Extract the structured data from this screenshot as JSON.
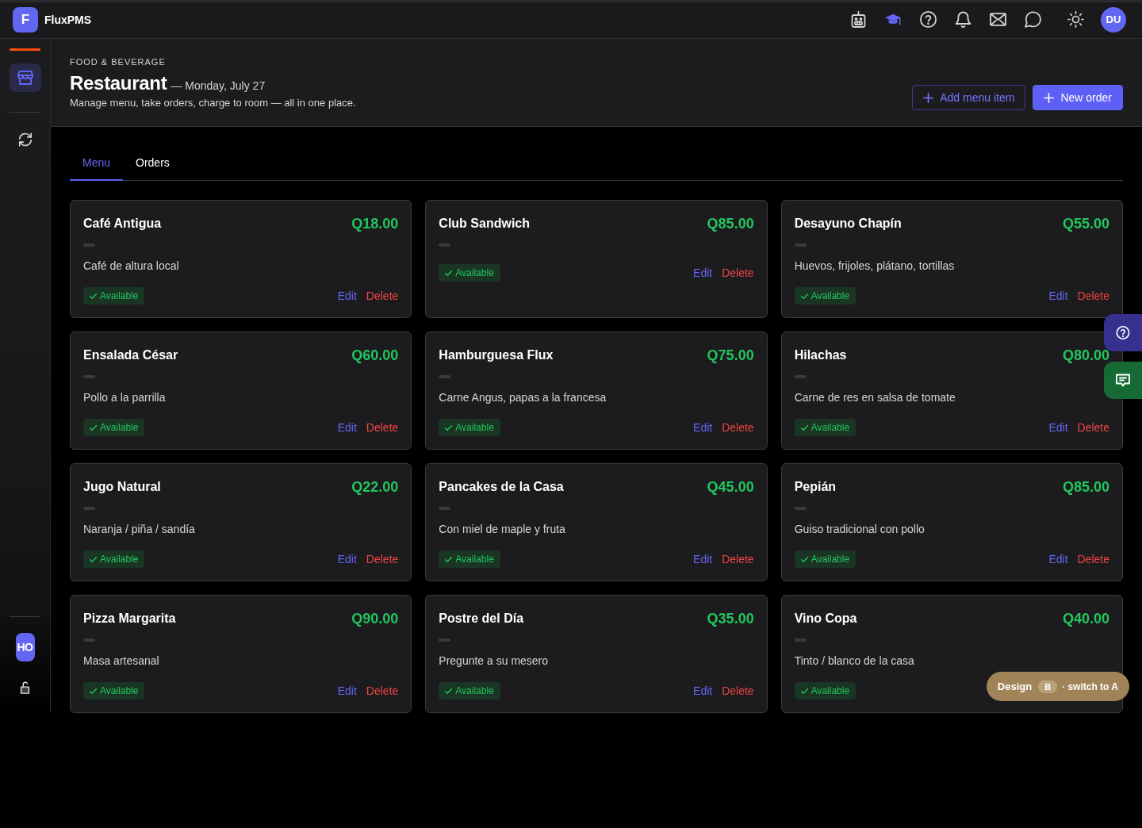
{
  "app": {
    "logo_letter": "F",
    "name": "FluxPMS"
  },
  "topbar": {
    "avatar": "DU"
  },
  "sidebar": {
    "items": [
      {
        "kind": "store",
        "selected": true
      },
      {
        "kind": "refresh",
        "selected": false
      }
    ],
    "property": "HO"
  },
  "header": {
    "eyebrow": "FOOD & BEVERAGE",
    "title": "Restaurant",
    "date": "— Monday, July 27",
    "subtitle": "Manage menu, take orders, charge to room — all in one place.",
    "buttons": [
      {
        "kind": "outline",
        "label": "Add menu item"
      },
      {
        "kind": "primary",
        "label": "New order"
      }
    ]
  },
  "tabs": [
    {
      "label": "Menu",
      "selected": true
    },
    {
      "label": "Orders",
      "selected": false
    }
  ],
  "menu_items": [
    {
      "name": "Café Antigua",
      "price": "Q18.00",
      "description": "Café de altura local",
      "status": "Available",
      "available": true,
      "edit": "Edit",
      "delete": "Delete"
    },
    {
      "name": "Club Sandwich",
      "price": "Q85.00",
      "status": "Available",
      "available": true,
      "edit": "Edit",
      "delete": "Delete"
    },
    {
      "name": "Desayuno Chapín",
      "price": "Q55.00",
      "description": "Huevos, frijoles, plátano, tortillas",
      "status": "Available",
      "available": true,
      "edit": "Edit",
      "delete": "Delete"
    },
    {
      "name": "Ensalada César",
      "price": "Q60.00",
      "description": "Pollo a la parrilla",
      "status": "Available",
      "available": true,
      "edit": "Edit",
      "delete": "Delete"
    },
    {
      "name": "Hamburguesa Flux",
      "price": "Q75.00",
      "description": "Carne Angus, papas a la francesa",
      "status": "Available",
      "available": true,
      "edit": "Edit",
      "delete": "Delete"
    },
    {
      "name": "Hilachas",
      "price": "Q80.00",
      "description": "Carne de res en salsa de tomate",
      "status": "Available",
      "available": true,
      "edit": "Edit",
      "delete": "Delete"
    },
    {
      "name": "Jugo Natural",
      "price": "Q22.00",
      "description": "Naranja / piña / sandía",
      "status": "Available",
      "available": true,
      "edit": "Edit",
      "delete": "Delete"
    },
    {
      "name": "Pancakes de la Casa",
      "price": "Q45.00",
      "description": "Con miel de maple y fruta",
      "status": "Available",
      "available": true,
      "edit": "Edit",
      "delete": "Delete"
    },
    {
      "name": "Pepián",
      "price": "Q85.00",
      "description": "Guiso tradicional con pollo",
      "status": "Available",
      "available": true,
      "edit": "Edit",
      "delete": "Delete"
    },
    {
      "name": "Pizza Margarita",
      "price": "Q90.00",
      "description": "Masa artesanal",
      "status": "Available",
      "available": true,
      "edit": "Edit",
      "delete": "Delete"
    },
    {
      "name": "Postre del Día",
      "price": "Q35.00",
      "description": "Pregunte a su mesero",
      "status": "Available",
      "available": true,
      "edit": "Edit",
      "delete": "Delete"
    },
    {
      "name": "Vino Copa",
      "price": "Q40.00",
      "description": "Tinto / blanco de la casa",
      "status": "Available",
      "available": true
    }
  ],
  "design_switch": {
    "label": "Design",
    "variant": "B",
    "action": "· switch to A"
  }
}
